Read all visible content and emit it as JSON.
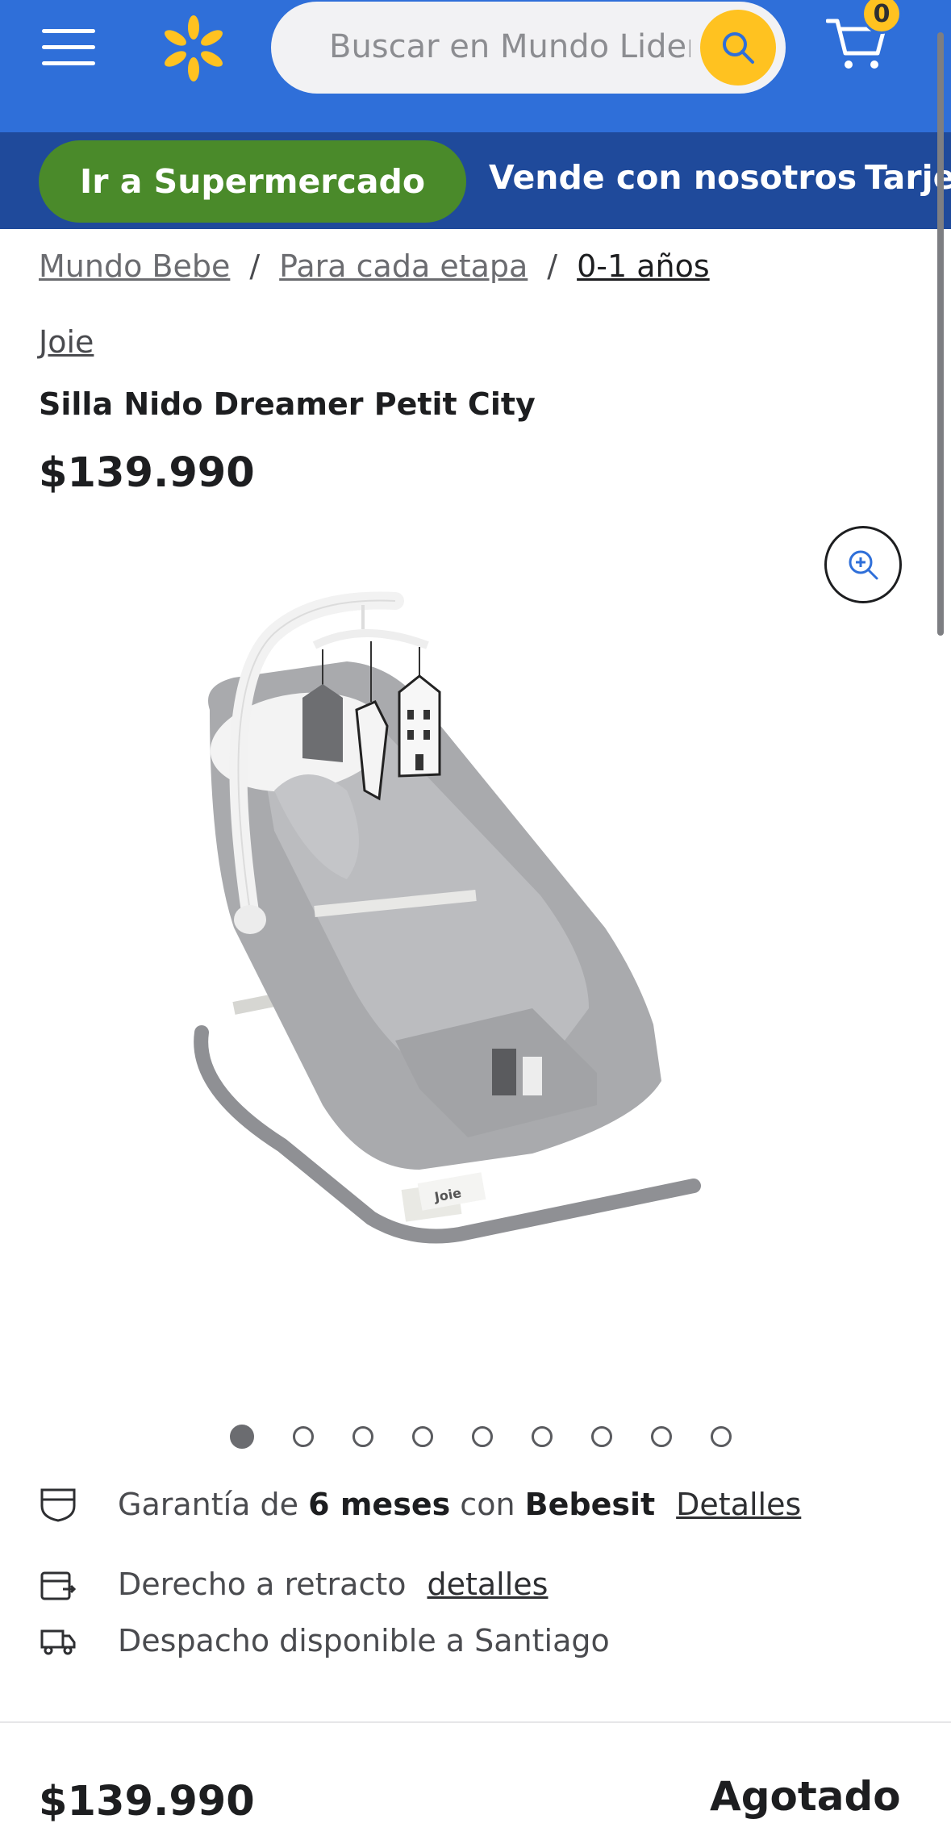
{
  "header": {
    "search_placeholder": "Buscar en Mundo Lider",
    "cart_count": "0",
    "icons": [
      "menu-icon",
      "spark-logo-icon",
      "search-icon",
      "cart-icon"
    ],
    "colors": {
      "header_bg": "#2f6fd9",
      "nav_bg": "#1f4a9b",
      "accent": "#ffc220",
      "green": "#4a8a2a"
    }
  },
  "nav": {
    "supermarket_button": "Ir a Supermercado",
    "links": [
      "Vende con nosotros",
      "Tarjeta"
    ]
  },
  "breadcrumb": [
    "Mundo Bebe",
    "Para cada etapa",
    "0-1 años"
  ],
  "product": {
    "brand": "Joie",
    "title": "Silla Nido Dreamer Petit City",
    "price": "$139.990",
    "image_dots_total": 9,
    "image_dots_active": 1,
    "warranty_prefix": "Garantía de",
    "warranty_months": "6 meses",
    "warranty_middle": "con",
    "warranty_brand": "Bebesit",
    "warranty_link": "Detalles",
    "retract_text": "Derecho a retracto",
    "retract_link": "detalles",
    "shipping_text": "Despacho disponible a Santiago"
  },
  "footer_bar": {
    "price": "$139.990",
    "status": "Agotado"
  }
}
